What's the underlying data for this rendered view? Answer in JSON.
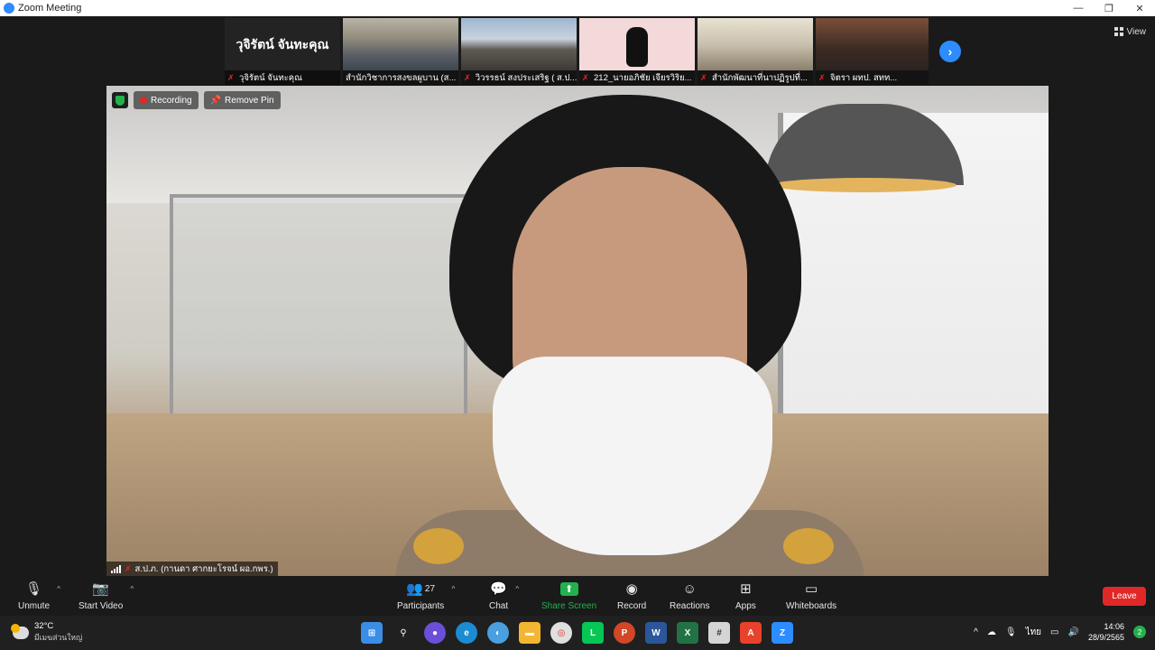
{
  "window": {
    "title": "Zoom Meeting",
    "controls": [
      "—",
      "❐",
      "✕"
    ]
  },
  "gallery": {
    "tiles": [
      {
        "big_name": "วุจิรัตน์ จันทะคุณ",
        "caption": "วุจิรัตน์ จันทะคุณ"
      },
      {
        "caption": "สำนักวิชาการสงขลผูบาน (ส..."
      },
      {
        "caption": "วิวรรธน์ สงประเสริฐ ( ส.ป...."
      },
      {
        "caption": "212_นายอภิชัย เจียรวิริย..."
      },
      {
        "caption": "สำนักพัฒนาที่นาปฏิรูปที่..."
      },
      {
        "caption": "จิตรา ผทป. สทท..."
      }
    ],
    "view_label": "View"
  },
  "main_video": {
    "recording_label": "Recording",
    "remove_pin_label": "Remove Pin",
    "speaker_name": "ส.ป.ภ. (กานดา ศากยะโรจน์ ผอ.กพร.)"
  },
  "toolbar": {
    "unmute": "Unmute",
    "start_video": "Start Video",
    "participants": "Participants",
    "participants_count": "27",
    "chat": "Chat",
    "share_screen": "Share Screen",
    "record": "Record",
    "reactions": "Reactions",
    "apps": "Apps",
    "whiteboards": "Whiteboards",
    "leave": "Leave"
  },
  "taskbar": {
    "temperature": "32°C",
    "condition": "มีเมฆส่วนใหญ่",
    "language": "ไทย",
    "time": "14:06",
    "date": "28/9/2565",
    "notification_count": "2"
  },
  "colors": {
    "accent_blue": "#2d8cff",
    "share_green": "#23b14d",
    "leave_red": "#e02828"
  }
}
